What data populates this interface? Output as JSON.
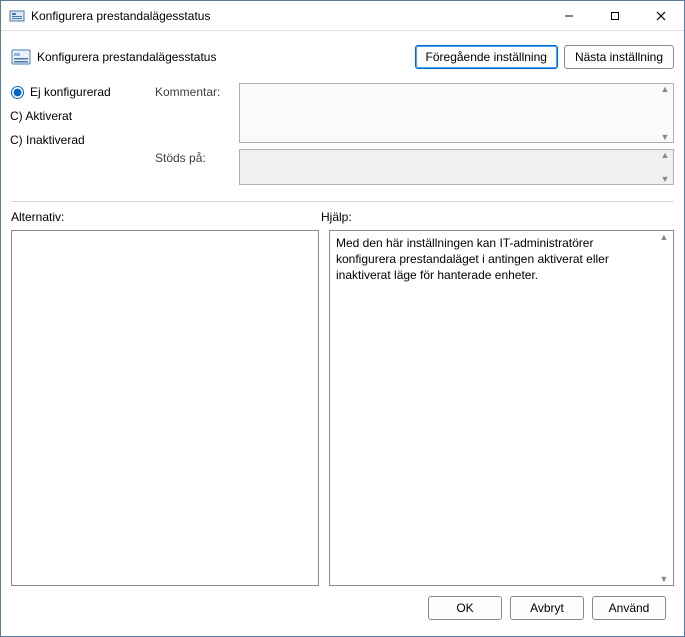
{
  "window": {
    "title": "Konfigurera prestandalägesstatus",
    "header_title": "Konfigurera prestandalägesstatus"
  },
  "nav": {
    "prev": "Föregående inställning",
    "next": "Nästa inställning"
  },
  "state": {
    "not_configured": "Ej konfigurerad",
    "enabled": "Aktiverat",
    "disabled": "Inaktiverad",
    "selected": "not_configured"
  },
  "labels": {
    "comment": "Kommentar:",
    "supported": "Stöds på:",
    "options": "Alternativ:",
    "help": "Hjälp:"
  },
  "fields": {
    "comment_value": "",
    "supported_value": ""
  },
  "help_text": "Med den här inställningen kan IT-administratörer konfigurera prestandaläget i antingen aktiverat eller inaktiverat läge för hanterade enheter.",
  "footer": {
    "ok": "OK",
    "cancel": "Avbryt",
    "apply": "Använd"
  }
}
